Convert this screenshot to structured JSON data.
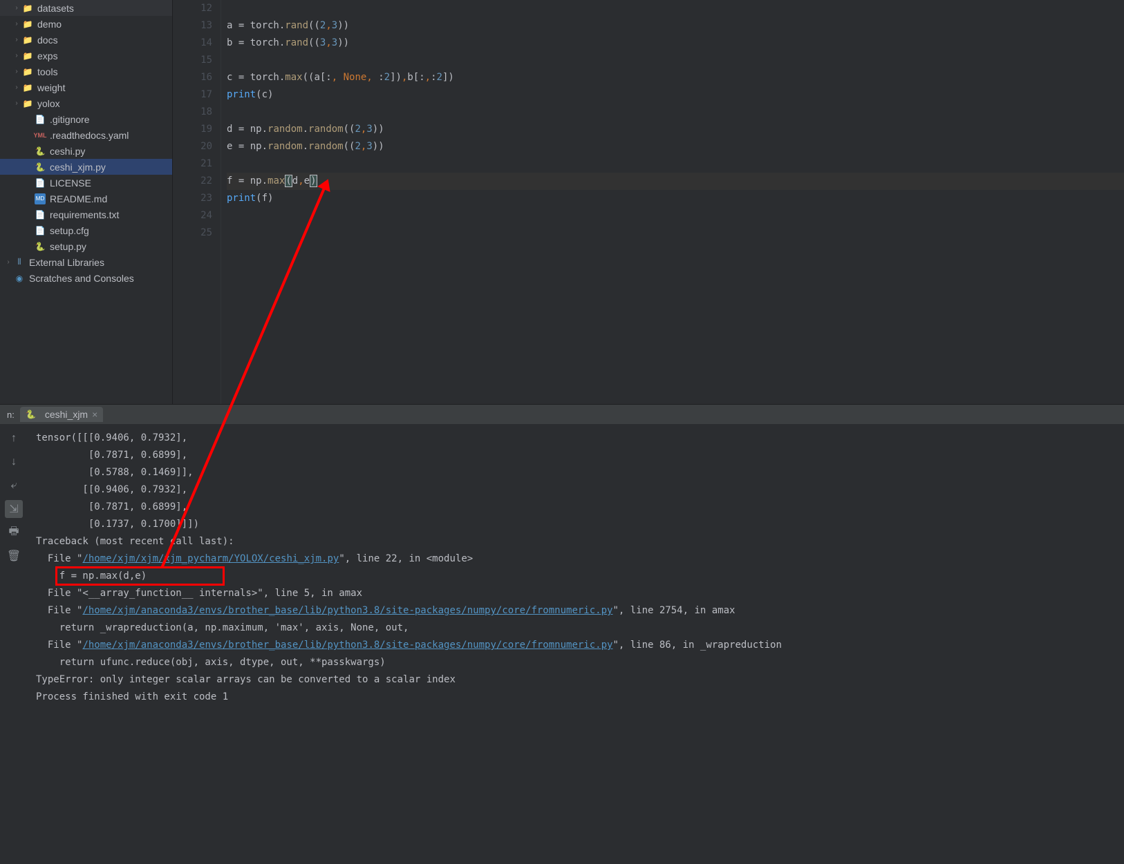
{
  "sidebar": {
    "items": [
      {
        "label": "datasets",
        "icon": "folder",
        "arrow": ">",
        "pad": 1
      },
      {
        "label": "demo",
        "icon": "folder",
        "arrow": ">",
        "pad": 1
      },
      {
        "label": "docs",
        "icon": "folder",
        "arrow": ">",
        "pad": 1
      },
      {
        "label": "exps",
        "icon": "folder",
        "arrow": ">",
        "pad": 1
      },
      {
        "label": "tools",
        "icon": "folder",
        "arrow": ">",
        "pad": 1
      },
      {
        "label": "weight",
        "icon": "folder",
        "arrow": ">",
        "pad": 1
      },
      {
        "label": "yolox",
        "icon": "folder",
        "arrow": ">",
        "pad": 1
      },
      {
        "label": ".gitignore",
        "icon": "file",
        "arrow": "",
        "pad": 2
      },
      {
        "label": ".readthedocs.yaml",
        "icon": "yaml",
        "arrow": "",
        "pad": 2
      },
      {
        "label": "ceshi.py",
        "icon": "py",
        "arrow": "",
        "pad": 2
      },
      {
        "label": "ceshi_xjm.py",
        "icon": "py",
        "arrow": "",
        "pad": 2,
        "selected": true
      },
      {
        "label": "LICENSE",
        "icon": "file",
        "arrow": "",
        "pad": 2
      },
      {
        "label": "README.md",
        "icon": "md",
        "arrow": "",
        "pad": 2
      },
      {
        "label": "requirements.txt",
        "icon": "file",
        "arrow": "",
        "pad": 2
      },
      {
        "label": "setup.cfg",
        "icon": "file",
        "arrow": "",
        "pad": 2
      },
      {
        "label": "setup.py",
        "icon": "py",
        "arrow": "",
        "pad": 2
      }
    ],
    "external_libs": "External Libraries",
    "scratches": "Scratches and Consoles"
  },
  "editor": {
    "line_start": 12,
    "line_end": 25,
    "lines": [
      "",
      "a = torch.rand((2,3))",
      "b = torch.rand((3,3))",
      "",
      "c = torch.max((a[:, None, :2]),b[:,:2])",
      "print(c)",
      "",
      "d = np.random.random((2,3))",
      "e = np.random.random((2,3))",
      "",
      "f = np.max(d,e)",
      "print(f)",
      "",
      ""
    ]
  },
  "run": {
    "label_prefix": "n:",
    "tab_name": "ceshi_xjm",
    "toolbar": [
      "arrow-up",
      "arrow-down",
      "wrap",
      "scroll",
      "print",
      "trash"
    ]
  },
  "console": {
    "lines": [
      "tensor([[[0.9406, 0.7932],",
      "         [0.7871, 0.6899],",
      "         [0.5788, 0.1469]],",
      "",
      "        [[0.9406, 0.7932],",
      "         [0.7871, 0.6899],",
      "         [0.1737, 0.1700]]])",
      "Traceback (most recent call last):"
    ],
    "file1_pre": "  File \"",
    "file1_link": "/home/xjm/xjm/xjm_pycharm/YOLOX/ceshi_xjm.py",
    "file1_post": "\", line 22, in <module>",
    "box_line": "    f = np.max(d,e)",
    "file2_pre": "  File \"<__array_function__ internals>\", line 5, in amax",
    "file3_pre": "  File \"",
    "file3_link": "/home/xjm/anaconda3/envs/brother_base/lib/python3.8/site-packages/numpy/core/fromnumeric.py",
    "file3_post": "\", line 2754, in amax",
    "ret1": "    return _wrapreduction(a, np.maximum, 'max', axis, None, out,",
    "file4_pre": "  File \"",
    "file4_link": "/home/xjm/anaconda3/envs/brother_base/lib/python3.8/site-packages/numpy/core/fromnumeric.py",
    "file4_post": "\", line 86, in _wrapreduction",
    "ret2": "    return ufunc.reduce(obj, axis, dtype, out, **passkwargs)",
    "error": "TypeError: only integer scalar arrays can be converted to a scalar index",
    "exit": "Process finished with exit code 1"
  }
}
